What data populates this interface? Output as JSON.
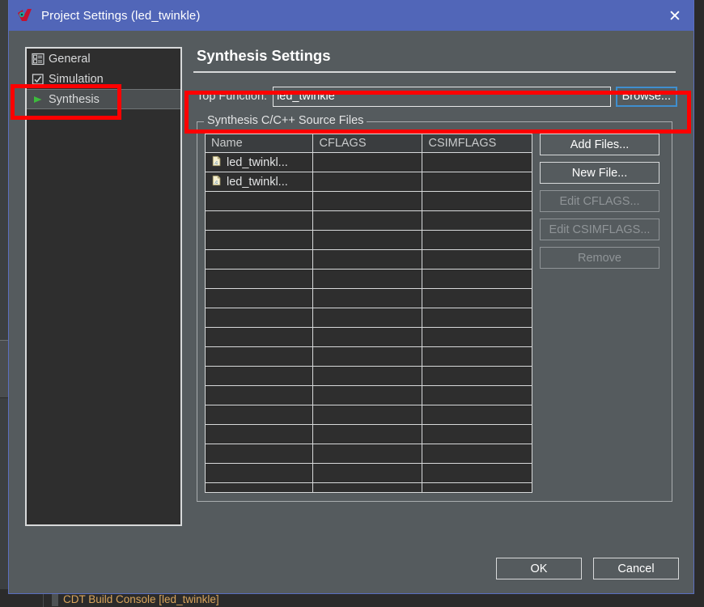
{
  "window": {
    "title": "Project Settings (led_twinkle)",
    "icon": "vivado-logo-icon",
    "close_label": "✕",
    "titlebar_color": "#5166b8",
    "background_color": "#555b5e"
  },
  "sidebar": {
    "items": [
      {
        "label": "General",
        "icon": "form-list-icon",
        "selected": false
      },
      {
        "label": "Simulation",
        "icon": "checkbox-icon",
        "selected": false
      },
      {
        "label": "Synthesis",
        "icon": "green-play-icon",
        "selected": true
      }
    ]
  },
  "main": {
    "heading": "Synthesis Settings",
    "top_function": {
      "label": "Top Function:",
      "value": "led_twinkle",
      "placeholder": "",
      "browse_label": "Browse..."
    },
    "group": {
      "legend": "Synthesis C/C++ Source Files",
      "table": {
        "columns": [
          "Name",
          "CFLAGS",
          "CSIMFLAGS"
        ],
        "rows": [
          {
            "name": "led_twinkl...",
            "icon": "c-file-icon",
            "cflags": "",
            "csimflags": ""
          },
          {
            "name": "led_twinkl...",
            "icon": "c-file-icon",
            "cflags": "",
            "csimflags": ""
          }
        ],
        "empty_row_count": 16
      },
      "buttons": [
        {
          "label": "Add Files...",
          "enabled": true
        },
        {
          "label": "New File...",
          "enabled": true
        },
        {
          "label": "Edit CFLAGS...",
          "enabled": false
        },
        {
          "label": "Edit CSIMFLAGS...",
          "enabled": false
        },
        {
          "label": "Remove",
          "enabled": false
        }
      ]
    }
  },
  "footer": {
    "ok_label": "OK",
    "cancel_label": "Cancel"
  },
  "background": {
    "console_tab_label": "CDT Build Console [led_twinkle]",
    "console_tab_color": "#d9a45b"
  },
  "annotations": {
    "highlight_color": "#ff0000",
    "boxes": [
      {
        "name": "sidebar-synthesis-highlight"
      },
      {
        "name": "top-function-highlight"
      }
    ]
  }
}
